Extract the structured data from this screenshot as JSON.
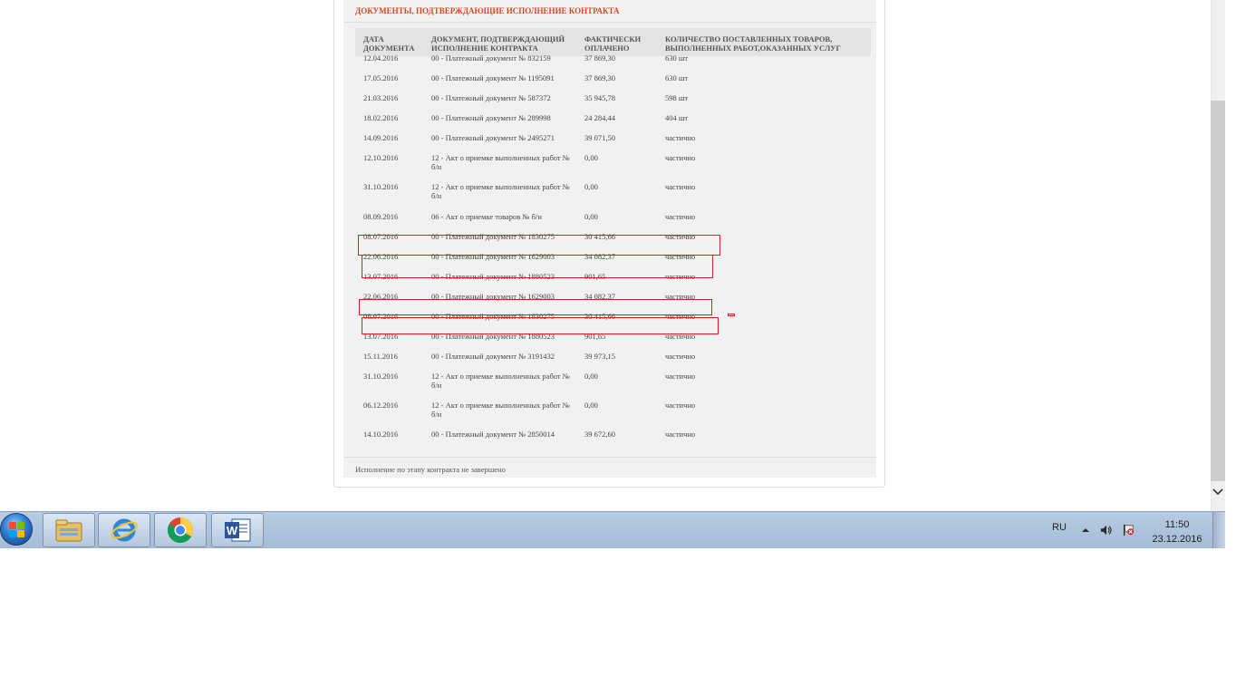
{
  "section": {
    "title": "ДОКУМЕНТЫ, ПОДТВЕРЖДАЮЩИЕ ИСПОЛНЕНИЕ КОНТРАКТА",
    "title_color": "#d24b23"
  },
  "table": {
    "columns": [
      {
        "line1": "ДАТА",
        "line2": "ДОКУМЕНТА"
      },
      {
        "line1": "ДОКУМЕНТ, ПОДТВЕРЖДАЮЩИЙ",
        "line2": "ИСПОЛНЕНИЕ КОНТРАКТА"
      },
      {
        "line1": "ФАКТИЧЕСКИ",
        "line2": "ОПЛАЧЕНО"
      },
      {
        "line1": "КОЛИЧЕСТВО ПОСТАВЛЕННЫХ ТОВАРОВ,",
        "line2": "ВЫПОЛНЕННЫХ РАБОТ,ОКАЗАННЫХ УСЛУГ"
      }
    ],
    "rows": [
      {
        "date": "12.04.2016",
        "doc": "00 - Платежный документ № 832159",
        "paid": "37 869,30",
        "qty": "630 шт"
      },
      {
        "date": "17.05.2016",
        "doc": "00 - Платежный документ № 1195091",
        "paid": "37 869,30",
        "qty": "630 шт"
      },
      {
        "date": "21.03.2016",
        "doc": "00 - Платежный документ № 587372",
        "paid": "35 945,78",
        "qty": "598 шт"
      },
      {
        "date": "18.02.2016",
        "doc": "00 - Платежный документ № 289998",
        "paid": "24 284,44",
        "qty": "404 шт"
      },
      {
        "date": "14.09.2016",
        "doc": "00 - Платежный документ № 2495271",
        "paid": "39 071,50",
        "qty": "частично"
      },
      {
        "date": "12.10.2016",
        "doc": "12 - Акт о приемке выполненных работ № б/н",
        "paid": "0,00",
        "qty": "частично"
      },
      {
        "date": "31.10.2016",
        "doc": "12 - Акт о приемке выполненных работ № б/н",
        "paid": "0,00",
        "qty": "частично"
      },
      {
        "date": "08.09.2016",
        "doc": "06 - Акт о приемке товаров № б/н",
        "paid": "0,00",
        "qty": "частично"
      },
      {
        "date": "08.07.2016",
        "doc": "00 - Платежный документ № 1830275",
        "paid": "30 415,66",
        "qty": "частично"
      },
      {
        "date": "22.06.2016",
        "doc": "00 - Платежный документ № 1629003",
        "paid": "34 082,37",
        "qty": "частично"
      },
      {
        "date": "13.07.2016",
        "doc": "00 - Платежный документ № 1880523",
        "paid": "901,65",
        "qty": "частично"
      },
      {
        "date": "22.06.2016",
        "doc": "00 - Платежный документ № 1629003",
        "paid": "34 082,37",
        "qty": "частично"
      },
      {
        "date": "08.07.2016",
        "doc": "00 - Платежный документ № 1830275",
        "paid": "30 415,66",
        "qty": "частично"
      },
      {
        "date": "13.07.2016",
        "doc": "00 - Платежный документ № 1880523",
        "paid": "901,65",
        "qty": "частично"
      },
      {
        "date": "15.11.2016",
        "doc": "00 - Платежный документ № 3191432",
        "paid": "39 973,15",
        "qty": "частично"
      },
      {
        "date": "31.10.2016",
        "doc": "12 - Акт о приемке выполненных работ № б/н",
        "paid": "0,00",
        "qty": "частично"
      },
      {
        "date": "06.12.2016",
        "doc": "12 - Акт о приемке выполненных работ № б/н",
        "paid": "0,00",
        "qty": "частично"
      },
      {
        "date": "14.10.2016",
        "doc": "00 - Платежный документ № 2850014",
        "paid": "39 672,60",
        "qty": "частично"
      }
    ]
  },
  "footer": {
    "text": "Исполнение по этапу контракта не завершено"
  },
  "highlight_color": "#d21f1f",
  "taskbar": {
    "buttons": [
      {
        "icon": "file-explorer-icon"
      },
      {
        "icon": "internet-explorer-icon"
      },
      {
        "icon": "chrome-icon"
      },
      {
        "icon": "word-icon",
        "letter": "W"
      }
    ],
    "language": "RU",
    "time": "11:50",
    "date": "23.12.2016"
  }
}
